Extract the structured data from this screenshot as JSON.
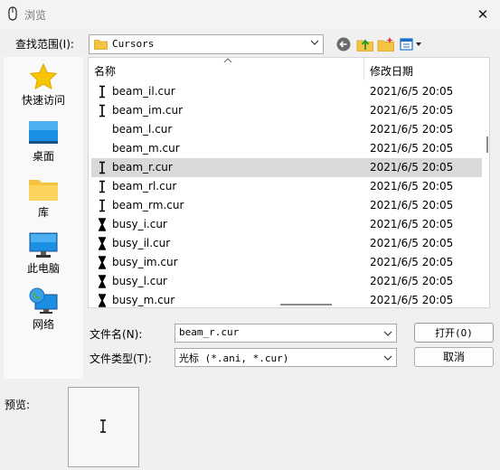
{
  "window": {
    "title": "浏览",
    "close_glyph": "✕"
  },
  "lookin": {
    "label": "查找范围(I):",
    "value": "Cursors"
  },
  "toolbar": {
    "back_icon": "back-arrow-icon",
    "up_icon": "up-folder-icon",
    "new_folder_icon": "new-folder-icon",
    "view_icon": "view-menu-icon"
  },
  "places": [
    {
      "label": "快速访问",
      "icon": "star-icon"
    },
    {
      "label": "桌面",
      "icon": "desktop-icon"
    },
    {
      "label": "库",
      "icon": "library-folder-icon"
    },
    {
      "label": "此电脑",
      "icon": "computer-icon"
    },
    {
      "label": "网络",
      "icon": "network-icon"
    }
  ],
  "filelist": {
    "columns": [
      "名称",
      "修改日期"
    ],
    "rows": [
      {
        "name": "beam_il.cur",
        "date": "2021/6/5 20:05",
        "icon": "beam-cursor-icon",
        "selected": false
      },
      {
        "name": "beam_im.cur",
        "date": "2021/6/5 20:05",
        "icon": "beam-cursor-icon",
        "selected": false
      },
      {
        "name": "beam_l.cur",
        "date": "2021/6/5 20:05",
        "icon": "blank-icon",
        "selected": false
      },
      {
        "name": "beam_m.cur",
        "date": "2021/6/5 20:05",
        "icon": "blank-icon",
        "selected": false
      },
      {
        "name": "beam_r.cur",
        "date": "2021/6/5 20:05",
        "icon": "beam-cursor-icon",
        "selected": true
      },
      {
        "name": "beam_rl.cur",
        "date": "2021/6/5 20:05",
        "icon": "beam-cursor-icon",
        "selected": false
      },
      {
        "name": "beam_rm.cur",
        "date": "2021/6/5 20:05",
        "icon": "beam-cursor-icon",
        "selected": false
      },
      {
        "name": "busy_i.cur",
        "date": "2021/6/5 20:05",
        "icon": "hourglass-icon",
        "selected": false
      },
      {
        "name": "busy_il.cur",
        "date": "2021/6/5 20:05",
        "icon": "hourglass-icon",
        "selected": false
      },
      {
        "name": "busy_im.cur",
        "date": "2021/6/5 20:05",
        "icon": "hourglass-icon",
        "selected": false
      },
      {
        "name": "busy_l.cur",
        "date": "2021/6/5 20:05",
        "icon": "hourglass-icon",
        "selected": false
      },
      {
        "name": "busy_m.cur",
        "date": "2021/6/5 20:05",
        "icon": "hourglass-icon",
        "selected": false
      }
    ]
  },
  "filename": {
    "label": "文件名(N):",
    "value": "beam_r.cur"
  },
  "filetype": {
    "label": "文件类型(T):",
    "value": "光标 (*.ani, *.cur)"
  },
  "buttons": {
    "open": "打开(O)",
    "cancel": "取消"
  },
  "preview": {
    "label": "预览:"
  },
  "colors": {
    "selection": "#d9d9d9",
    "star": "#f7c600",
    "folder": "#f5c242",
    "accent": "#1a8fe3"
  }
}
